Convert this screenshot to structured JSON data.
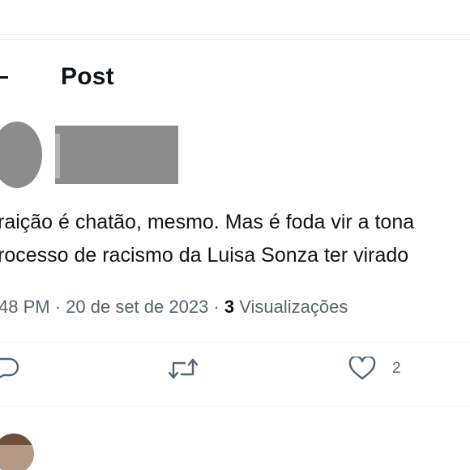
{
  "header": {
    "title": "Post",
    "back_icon": "arrow-left-icon"
  },
  "post": {
    "text_lines": [
      "raição é chatão, mesmo. Mas é foda vir a tona",
      "rocesso de racismo da Luisa Sonza ter virado"
    ],
    "meta": {
      "time": "48 PM",
      "separator": " · ",
      "date": "20 de set de 2023",
      "views_count": "3",
      "views_label": "Visualizações"
    }
  },
  "actions": {
    "reply_icon": "reply-icon",
    "retweet_icon": "retweet-icon",
    "like_icon": "heart-icon",
    "like_count": "2"
  },
  "colors": {
    "text": "#0f1419",
    "secondary": "#536471",
    "divider": "#eff3f4",
    "redaction": "#8c8c8c"
  }
}
